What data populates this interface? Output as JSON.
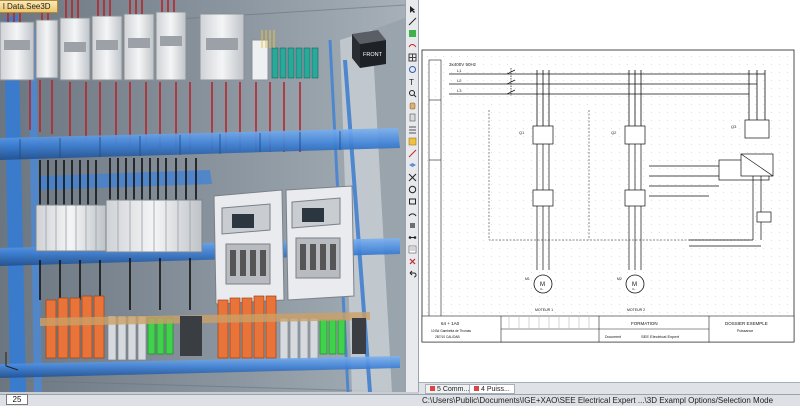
{
  "window": {
    "doc_tab_3d": "l Data.See3D",
    "zoom_value": "25",
    "status_path": "C:\\Users\\Public\\Documents\\IGE+XAO\\SEE Electrical Expert ...\\3D Exampl",
    "status_mode": "Options/Selection Mode"
  },
  "view3d": {
    "view_cube_label": "FRONT"
  },
  "sheet_tabs": [
    {
      "label": "5 Comm..."
    },
    {
      "label": "4 Puiss..."
    }
  ],
  "schematic": {
    "supply_label": "3x400V 50Hz",
    "phases": [
      "L1",
      "L2",
      "L3"
    ],
    "breakers": [
      "Q1",
      "Q2",
      "Q3"
    ],
    "motors": [
      {
        "tag": "M1",
        "symbol": "M",
        "sub": "3~",
        "caption": "MOTEUR 1"
      },
      {
        "tag": "M2",
        "symbol": "M",
        "sub": "3~",
        "caption": "MOTEUR 2"
      }
    ],
    "title_block": {
      "left_line1": "64 + 1A0",
      "left_line2": "10 Bd Gambetta de Thomas",
      "left_line3": "2B7/10 CALIDAB",
      "doc_label": "Document",
      "company": "SEE Electrical Expert",
      "center_title": "FORMATION",
      "project": "DOSSIER EXEMPLE",
      "sheet_title": "Puissance"
    }
  },
  "colors": {
    "accent_tab": "#efc76d",
    "rail_blue": "#3f82d8",
    "wire_red": "#b8242c",
    "wire_black": "#121212",
    "terminal_orange": "#e8743a",
    "terminal_green": "#3fd24a"
  }
}
